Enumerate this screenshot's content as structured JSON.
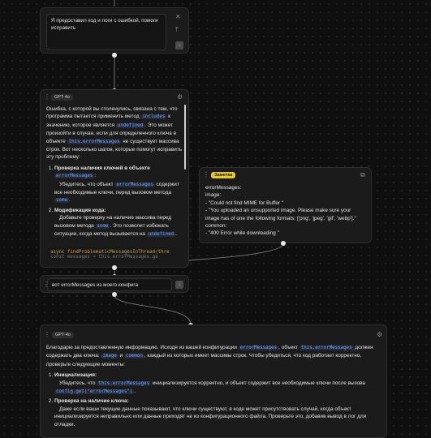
{
  "input_node_1": {
    "text": "Я предоставил код и логи с ошибкой, помоги исправить",
    "close_icon": "close-icon",
    "upload_icon": "upload-icon",
    "send_icon": "arrow-down-icon"
  },
  "response_1": {
    "model": "GPT-4o",
    "intro_a": "Ошибка, с которой вы столкнулись, связана с тем, что программа пытается применить метод",
    "code_includes": "includes",
    "intro_b": "к значению, которое является",
    "code_undefined": "undefined",
    "intro_c": ". Это может произойти в случае, если для определенного ключа в объекте",
    "code_this_error_messages": "this.errorMessages",
    "intro_d": "не существует массива строк. Вот несколько шагов, которые помогут исправить эту проблему:",
    "step1_title": "Проверка наличия ключей в объекте",
    "step1_code": "errorMessages",
    "step1_colon": ":",
    "step1_body_a": "Убедитесь, что объект",
    "step1_body_code": "errorMessages",
    "step1_body_b": "содержит все необходимые ключи, перед вызовом метода",
    "step1_body_code2": "some",
    "step1_body_c": ".",
    "step2_title": "Модификация кода:",
    "step2_body_a": "Добавьте проверку на наличие массива перед вызовом метода",
    "step2_body_code": "some",
    "step2_body_b": ". Это позволит избежать ситуации, когда метод вызывается на",
    "step2_body_code2": "undefined",
    "step2_body_c": ".",
    "code_line": "async findProblematicMessagesInThread(thre",
    "code_line2": "const messages = this.errorMessages.ge"
  },
  "note": {
    "badge": "Заметка",
    "lines": [
      "errorMessages:",
      "image:",
      "- \"Could not find MIME for Buffer \"",
      "- \"You uploaded an unsupported image. Please make sure your image has of one the following formats: ['png', 'jpeg', 'gif', 'webp'].\"",
      "common:",
      "- \"400 Error while downloading \""
    ]
  },
  "input_node_2": {
    "text": "вот errorMessages из моего конфига"
  },
  "response_2": {
    "model": "GPT-4o",
    "p1_a": "Благодарю за предоставленную информацию. Исходя из вашей конфигурации",
    "p1_code1": "errorMessages",
    "p1_b": ", объект",
    "p1_code2": "this.errorMessages",
    "p1_c": "должен содержать два ключа:",
    "p1_code3": "image",
    "p1_d": "и",
    "p1_code4": "common",
    "p1_e": ", каждый из которых имеет массивы строк. Чтобы убедиться, что код работает корректно, проверьте следующие моменты:",
    "s1_title": "Инициализация:",
    "s1_a": "Убедитесь, что",
    "s1_code": "this.errorMessages",
    "s1_b": "инициализируется корректно, и объект содержит все необходимые ключи после вызова",
    "s1_code2": "config.get(\"errorMessages\")",
    "s1_c": ".",
    "s2_title": "Проверка на наличие ключа:",
    "s2_body": "Даже если ваши текущие данные показывают, что ключи существуют, в коде может присутствовать случай, когда объект инициализируется неправильно или данные приходят не из конфигурационного файла. Проверьте это, добавив вывод в лог для отладки."
  }
}
